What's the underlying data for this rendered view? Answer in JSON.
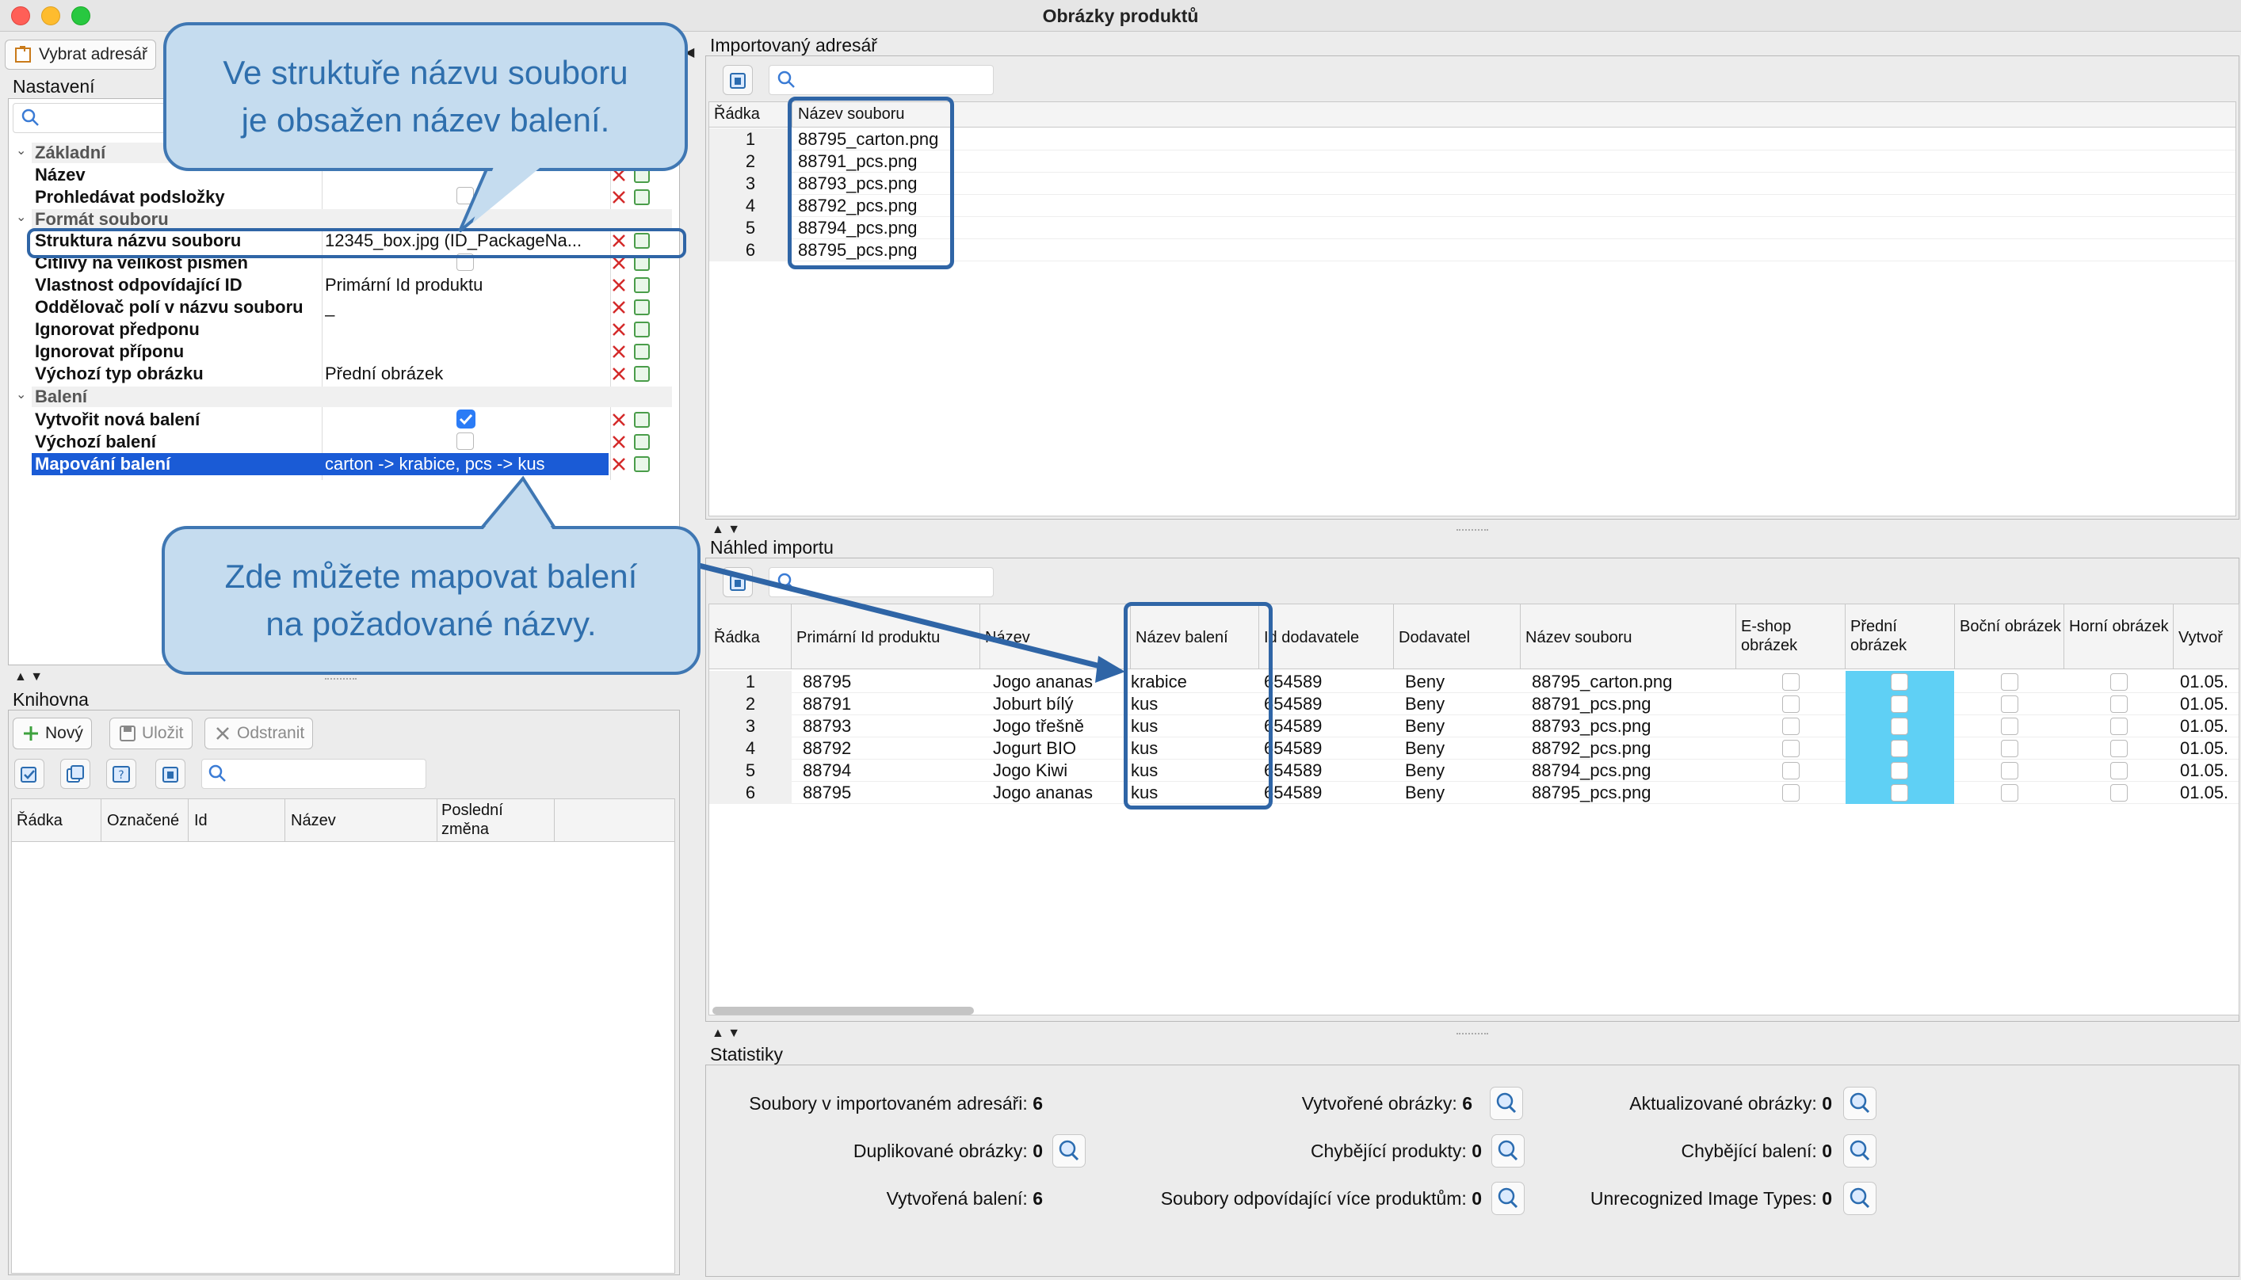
{
  "window": {
    "title": "Obrázky produktů"
  },
  "toolbar": {
    "select_dir_label": "Vybrat adresář"
  },
  "settings": {
    "title": "Nastavení",
    "groups": {
      "basic": "Základní",
      "file_format": "Formát souboru",
      "packaging": "Balení"
    },
    "rows": [
      {
        "label": "Název",
        "value": ""
      },
      {
        "label": "Prohledávat podsložky",
        "value": ""
      },
      {
        "label": "Struktura názvu souboru",
        "value": "12345_box.jpg (ID_PackageNa..."
      },
      {
        "label": "Citlivý na velikost písmen",
        "value": ""
      },
      {
        "label": "Vlastnost odpovídající ID",
        "value": "Primární Id produktu"
      },
      {
        "label": "Oddělovač polí v názvu souboru",
        "value": "_"
      },
      {
        "label": "Ignorovat předponu",
        "value": ""
      },
      {
        "label": "Ignorovat příponu",
        "value": ""
      },
      {
        "label": "Výchozí typ obrázku",
        "value": "Přední obrázek"
      },
      {
        "label": "Vytvořit nová balení",
        "value": ""
      },
      {
        "label": "Výchozí balení",
        "value": ""
      },
      {
        "label": "Mapování balení",
        "value": "carton -> krabice, pcs -> kus"
      }
    ]
  },
  "library": {
    "title": "Knihovna",
    "new_label": "Nový",
    "save_label": "Uložit",
    "remove_label": "Odstranit",
    "columns": [
      "Řádka",
      "Označené",
      "Id",
      "Název",
      "Poslední změna"
    ]
  },
  "imported_dir": {
    "title": "Importovaný adresář",
    "columns": [
      "Řádka",
      "Název souboru"
    ],
    "rows": [
      [
        "1",
        "88795_carton.png"
      ],
      [
        "2",
        "88791_pcs.png"
      ],
      [
        "3",
        "88793_pcs.png"
      ],
      [
        "4",
        "88792_pcs.png"
      ],
      [
        "5",
        "88794_pcs.png"
      ],
      [
        "6",
        "88795_pcs.png"
      ]
    ]
  },
  "preview": {
    "title": "Náhled importu",
    "columns": [
      "Řádka",
      "Primární Id produktu",
      "Název",
      "Název balení",
      "Id dodavatele",
      "Dodavatel",
      "Název souboru",
      "E-shop obrázek",
      "Přední obrázek",
      "Boční obrázek",
      "Horní obrázek",
      "Vytvoř"
    ],
    "rows": [
      [
        "1",
        "88795",
        "Jogo ananas",
        "krabice",
        "654589",
        "Beny",
        "88795_carton.png",
        "01.05."
      ],
      [
        "2",
        "88791",
        "Joburt bílý",
        "kus",
        "654589",
        "Beny",
        "88791_pcs.png",
        "01.05."
      ],
      [
        "3",
        "88793",
        "Jogo třešně",
        "kus",
        "654589",
        "Beny",
        "88793_pcs.png",
        "01.05."
      ],
      [
        "4",
        "88792",
        "Jogurt BIO",
        "kus",
        "654589",
        "Beny",
        "88792_pcs.png",
        "01.05."
      ],
      [
        "5",
        "88794",
        "Jogo Kiwi",
        "kus",
        "654589",
        "Beny",
        "88794_pcs.png",
        "01.05."
      ],
      [
        "6",
        "88795",
        "Jogo ananas",
        "kus",
        "654589",
        "Beny",
        "88795_pcs.png",
        "01.05."
      ]
    ]
  },
  "stats": {
    "title": "Statistiky",
    "items": [
      {
        "label": "Soubory v importovaném adresáři:",
        "value": "6"
      },
      {
        "label": "Vytvořené obrázky:",
        "value": "6"
      },
      {
        "label": "Aktualizované obrázky:",
        "value": "0"
      },
      {
        "label": "Duplikované obrázky:",
        "value": "0"
      },
      {
        "label": "Chybějící produkty:",
        "value": "0"
      },
      {
        "label": "Chybějící balení:",
        "value": "0"
      },
      {
        "label": "Vytvořená balení:",
        "value": "6"
      },
      {
        "label": "Soubory odpovídající více produktům:",
        "value": "0"
      },
      {
        "label": "Unrecognized Image Types:",
        "value": "0"
      }
    ]
  },
  "callouts": {
    "top_line1": "Ve struktuře názvu souboru",
    "top_line2": "je obsažen název balení.",
    "bottom_line1": "Zde můžete mapovat balení",
    "bottom_line2": "na požadované názvy."
  },
  "colors": {
    "selection": "#1a5bd6",
    "front_image_highlight": "#5fd0f5",
    "callout_fill": "#c5dcef",
    "callout_border": "#3f77b3",
    "highlight_border": "#2f65a6"
  }
}
